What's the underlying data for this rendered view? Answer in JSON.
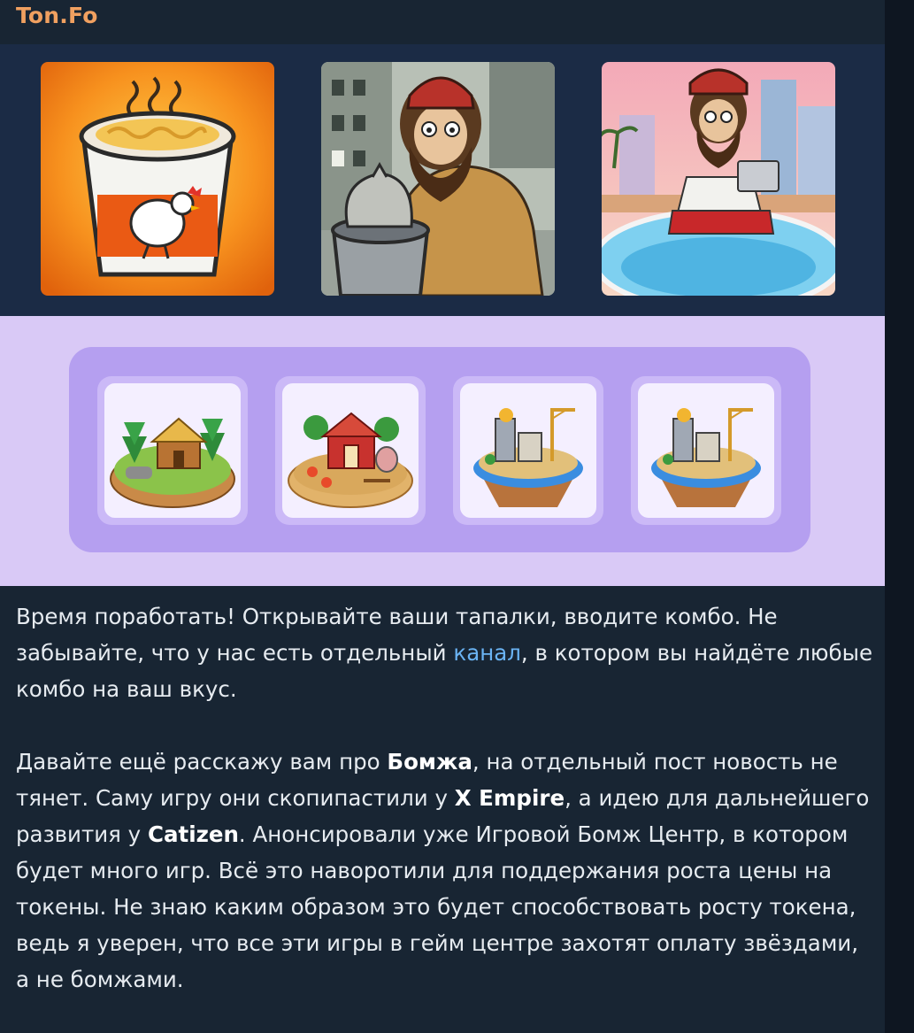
{
  "channel": {
    "name": "Ton.Fo",
    "name_color": "#f0a060"
  },
  "images": [
    {
      "name": "noodle-cup-image",
      "description": "Noodle cup with chicken logo"
    },
    {
      "name": "homeless-trash-image",
      "description": "Bearded man at trash can"
    },
    {
      "name": "homeless-laptop-image",
      "description": "Bearded man with laptop at pool"
    }
  ],
  "combo_cards": [
    {
      "name": "combo-card-cabin"
    },
    {
      "name": "combo-card-farm"
    },
    {
      "name": "combo-card-city-island"
    },
    {
      "name": "combo-card-city-island"
    }
  ],
  "message": {
    "p1_part1": "Время поработать! Открывайте ваши тапалки, вводите комбо. Не забывайте, что у нас есть отдельный ",
    "p1_link": "канал",
    "p1_part2": ", в котором вы найдёте любые комбо на ваш вкус.",
    "p2_t1": "Давайте ещё расскажу вам про ",
    "p2_b1": "Бомжа",
    "p2_t2": ", на отдельный пост новость не тянет. Саму игру они скопипастили у ",
    "p2_b2": "X Empire",
    "p2_t3": ", а идею для дальнейшего развития у ",
    "p2_b3": "Catizen",
    "p2_t4": ". Анонсировали уже Игровой Бомж Центр, в котором будет много игр. Всё это наворотили для поддержания роста цены на токены. Не знаю каким образом это будет способствовать росту токена, ведь я уверен, что все эти игры в гейм центре захотят оплату звёздами, а не бомжами."
  },
  "colors": {
    "background": "#0e1621",
    "bubble": "#182533",
    "link": "#6ab3f3",
    "combo_panel": "#d9c9f6",
    "combo_tray": "#b59ff0"
  }
}
